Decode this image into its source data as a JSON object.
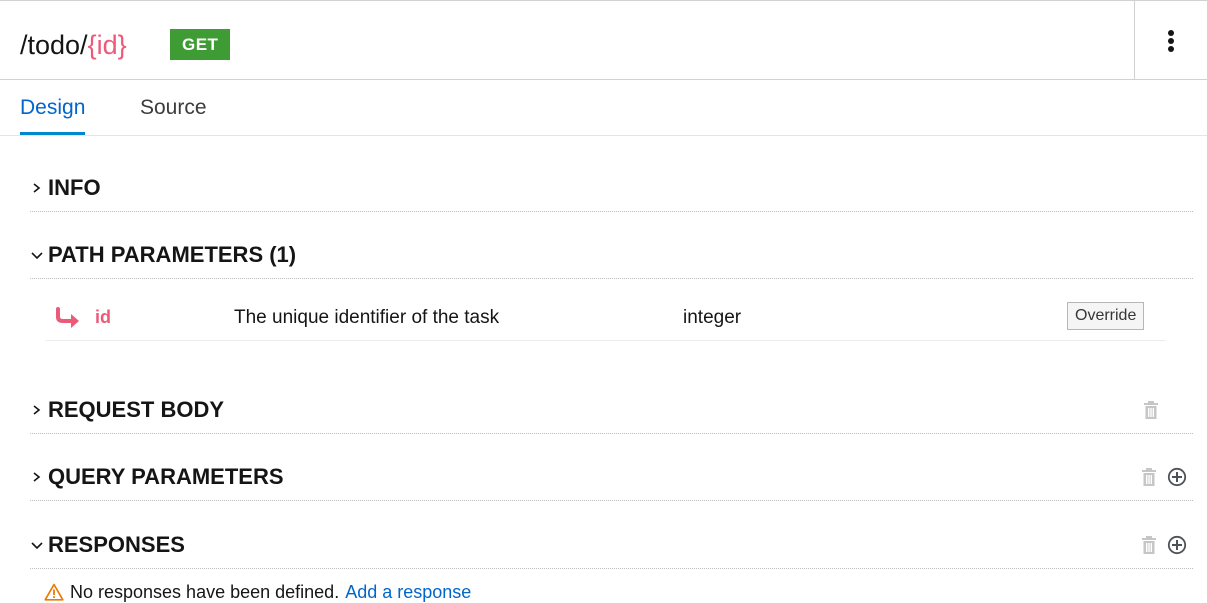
{
  "header": {
    "path_prefix": "/todo/",
    "path_param": "{id}",
    "method": "GET",
    "colors": {
      "method_badge": "#3f9c35",
      "path_param": "#ec5a7a"
    }
  },
  "tabs": [
    {
      "label": "Design",
      "active": true
    },
    {
      "label": "Source",
      "active": false
    }
  ],
  "sections": {
    "info": {
      "title": "INFO",
      "expanded": false
    },
    "path_parameters": {
      "title": "PATH PARAMETERS (1)",
      "expanded": true,
      "params": [
        {
          "name": "id",
          "description": "The unique identifier of the task",
          "type": "integer",
          "override_label": "Override"
        }
      ]
    },
    "request_body": {
      "title": "REQUEST BODY",
      "expanded": false
    },
    "query_parameters": {
      "title": "QUERY PARAMETERS",
      "expanded": false
    },
    "responses": {
      "title": "RESPONSES",
      "expanded": true,
      "empty_message": "No responses have been defined.",
      "add_link": "Add a response"
    }
  },
  "icons": {
    "kebab": "kebab-menu-icon",
    "chevron_right": "chevron-right-icon",
    "chevron_down": "chevron-down-icon",
    "trash": "trash-icon",
    "add": "add-circle-icon",
    "warning": "warning-icon",
    "param_arrow": "path-param-arrow-icon"
  }
}
